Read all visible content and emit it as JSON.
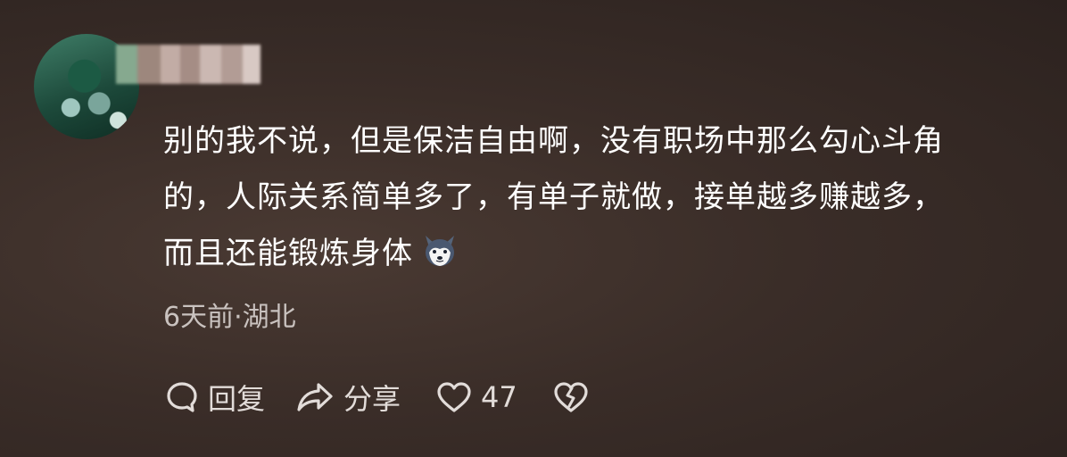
{
  "comment": {
    "avatar_icon": "avatar-icon",
    "text_lines": [
      "别的我不说，但是保洁自由啊，没有职场中那么勾心斗角",
      "的，人际关系简单多了，有单子就做，接单越多赚越多，",
      "而且还能锻炼身体"
    ],
    "emoji_icon": "husky-emoji-icon",
    "meta": "6天前·湖北"
  },
  "actions": {
    "reply_label": "回复",
    "share_label": "分享",
    "like_count": "47"
  }
}
